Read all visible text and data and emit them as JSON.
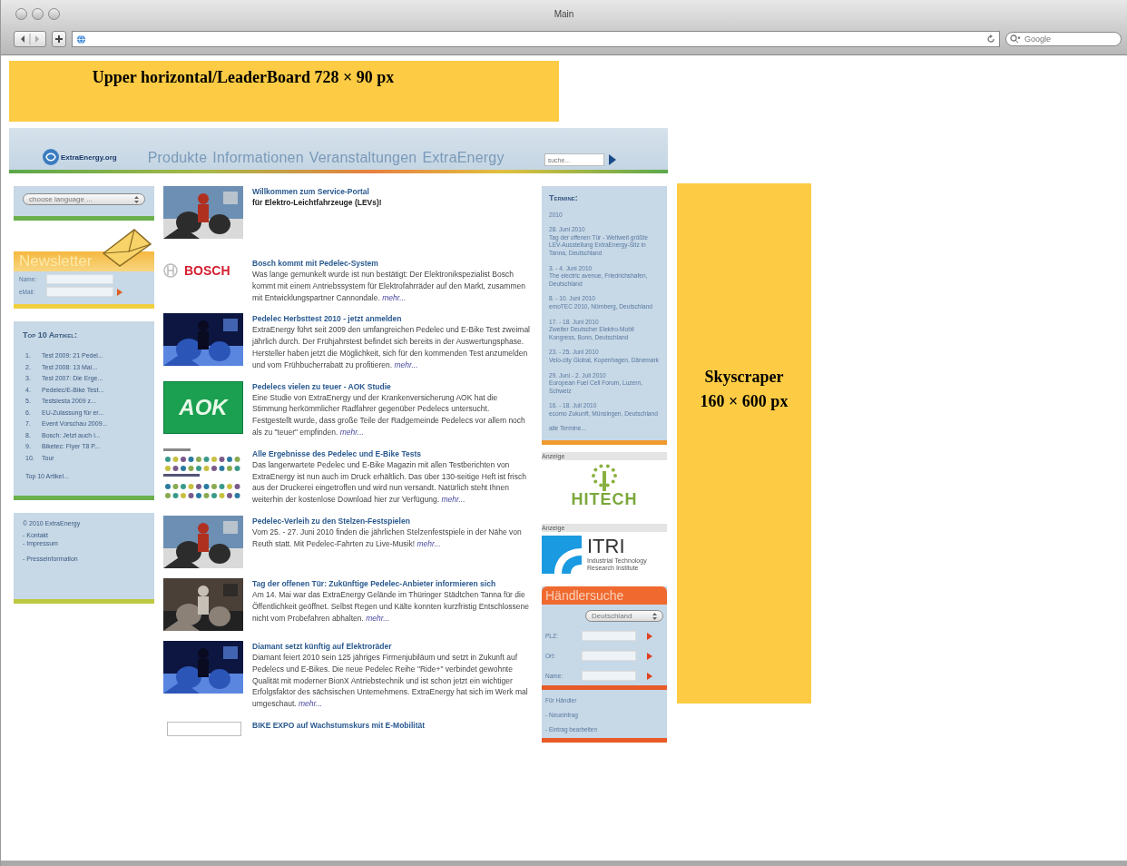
{
  "window": {
    "title": "Main"
  },
  "toolbar": {
    "search_placeholder": "Google"
  },
  "leaderboard": {
    "label": "Upper horizontal/LeaderBoard 728 × 90 px"
  },
  "skyscraper": {
    "lines": [
      "Skyscraper",
      "160 × 600 px"
    ]
  },
  "site": {
    "logo": "ExtraEnergy.org",
    "nav": [
      "Produkte",
      "Informationen",
      "Veranstaltungen",
      "ExtraEnergy"
    ],
    "search_placeholder": "suche...",
    "language_select": "choose language ...",
    "newsletter": {
      "title": "Newsletter",
      "fields": [
        "Name:",
        "eMail:"
      ]
    },
    "top10": {
      "title": "Top 10 Artikel:",
      "items": [
        {
          "number": "1.",
          "text": "Test 2009: 21 Pedel..."
        },
        {
          "number": "2.",
          "text": "Test 2008: 13 Mal..."
        },
        {
          "number": "3.",
          "text": "Test 2007: Die Erge..."
        },
        {
          "number": "4.",
          "text": "Pedelec/E-Bike Test..."
        },
        {
          "number": "5.",
          "text": "Testsiesta 2009 z..."
        },
        {
          "number": "6.",
          "text": "EU-Zulassung für er..."
        },
        {
          "number": "7.",
          "text": "Event Vorschau 2009..."
        },
        {
          "number": "8.",
          "text": "Bosch: Jetzt auch i..."
        },
        {
          "number": "9.",
          "text": "Biketec: Flyer T8 P..."
        },
        {
          "number": "10.",
          "text": "Tour"
        }
      ],
      "more": "Top 10 Artikel..."
    },
    "footer": {
      "copyright": "© 2010 ExtraEnergy",
      "links": [
        "- Kontakt",
        "- Impressum",
        "- Presseinformation"
      ]
    },
    "articles": [
      {
        "title": "Willkommen zum Service-Portal",
        "subtitle": "für Elektro-Leichtfahrzeuge (LEVs)!"
      },
      {
        "image": {
          "kind": "wordmark",
          "text": "BOSCH"
        },
        "title": "Bosch kommt mit Pedelec-System",
        "body": "Was lange gemunkelt wurde ist nun bestätigt: Der Elektronikspezialist Bosch kommt mit einem Antriebssystem für Elektrofahrräder auf den Markt, zusammen mit Entwicklungspartner Cannondale.",
        "more": "mehr..."
      },
      {
        "title": "Pedelec Herbsttest 2010 - jetzt anmelden",
        "body": "ExtraEnergy führt seit 2009 den umfangreichen Pedelec und E-Bike Test zweimal jährlich durch. Der Frühjahrstest befindet sich bereits in der Auswertungsphase. Hersteller haben jetzt die Möglichkeit, sich für den kommenden Test anzumelden und vom Frühbucherrabatt zu profitieren.",
        "more": "mehr..."
      },
      {
        "image": {
          "kind": "badge",
          "text": "AOK"
        },
        "title": "Pedelecs vielen zu teuer - AOK Studie",
        "body": "Eine Studie von ExtraEnergy und der Krankenversicherung AOK hat die Stimmung herkömmlicher Radfahrer gegenüber Pedelecs untersucht. Festgestellt wurde, dass große Teile der Radgemeinde Pedelecs vor allem noch als zu \"teuer\" empfinden.",
        "more": "mehr..."
      },
      {
        "image": {
          "kind": "dots"
        },
        "title": "Alle Ergebnisse des Pedelec und E-Bike Tests",
        "body": "Das langerwartete Pedelec und E-Bike Magazin mit allen Testberichten von ExtraEnergy ist nun auch im Druck erhältlich. Das über 130-seitige Heft ist frisch aus der Druckerei eingetroffen und wird nun versandt. Natürlich steht Ihnen weiterhin der kostenlose Download hier zur Verfügung.",
        "more": "mehr..."
      },
      {
        "title": "Pedelec-Verleih zu den Stelzen-Festspielen",
        "body": "Vom 25. - 27. Juni 2010 finden die jährlichen Stelzenfestspiele in der Nähe von Reuth statt. Mit Pedelec-Fahrten zu Live-Musik!",
        "more": "mehr..."
      },
      {
        "title": "Tag der offenen Tür: Zukünftige Pedelec-Anbieter informieren sich",
        "body": "Am 14. Mai war das ExtraEnergy Gelände im Thüringer Städtchen Tanna für die Öffentlichkeit geöffnet. Selbst Regen und Kälte konnten kurzfristig Entschlossene nicht vom Probefahren abhalten.",
        "more": "mehr..."
      },
      {
        "title": "Diamant setzt künftig auf Elektroräder",
        "body": "Diamant feiert 2010 sein 125 jähriges Firmenjubiläum und setzt in Zukunft auf Pedelecs und E-Bikes. Die neue Pedelec Reihe \"Ride+\" verbindet gewohnte Qualität mit moderner BionX Antriebstechnik und ist schon jetzt ein wichtiger Erfolgsfaktor des sächsischen Unternehmens. ExtraEnergy hat sich im Werk mal umgeschaut.",
        "more": "mehr..."
      },
      {
        "image": {
          "kind": "frame"
        },
        "title": "BIKE EXPO auf Wachstumskurs mit E-Mobilität"
      }
    ],
    "events": {
      "title": "Termine:",
      "year": "2010",
      "items": [
        {
          "date": "28. Juni 2010",
          "text": "Tag der offenen Tür - Weltweit größte LEV-Ausstellung ExtraEnergy-Sitz in Tanna, Deutschland"
        },
        {
          "date": "3. - 4. Juni 2010",
          "text": "The electric avenue, Friedrichshafen, Deutschland"
        },
        {
          "date": "8. - 10. Juni 2010",
          "text": "emoTEC 2010, Nürnberg, Deutschland"
        },
        {
          "date": "17. - 18. Juni 2010",
          "text": "Zweiter Deutscher Elektro-Mobil Kongress, Bonn, Deutschland"
        },
        {
          "date": "23. - 25. Juni 2010",
          "text": "Velo-city Global, Kopenhagen, Dänemark"
        },
        {
          "date": "29. Juni - 2. Juli 2010",
          "text": "European Fuel Cell Forum, Luzern, Schweiz"
        },
        {
          "date": "16. - 18. Juli 2010",
          "text": "ecomo Zukunft, Münsingen, Deutschland"
        }
      ],
      "more": "alle Termine..."
    },
    "ads": [
      {
        "label": "Anzeige",
        "kind": "hitech",
        "text": "HITECH"
      },
      {
        "label": "Anzeige",
        "kind": "itri",
        "text": "ITRI",
        "subtitle": "Industrial Technology Research Institute"
      }
    ],
    "dealer_search": {
      "title": "Händlersuche",
      "country": "Deutschland",
      "fields": [
        "PLZ:",
        "Ort:",
        "Name:"
      ],
      "section": "Für Händler",
      "links": [
        "- Neueintrag",
        "- Eintrag bearbeiten"
      ]
    }
  }
}
